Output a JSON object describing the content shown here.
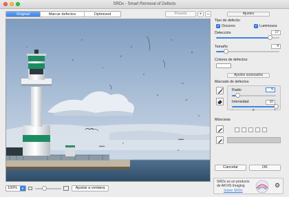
{
  "window": {
    "title": "SRDx - Smart Removal of Defects"
  },
  "view_tabs": [
    {
      "label": "Original",
      "active": true
    },
    {
      "label": "Marcar defectos",
      "active": false
    },
    {
      "label": "Optimized",
      "active": false
    }
  ],
  "presets": {
    "label": "Presets",
    "add": "+",
    "remove": "–"
  },
  "zoom": {
    "value": "100%",
    "slider_fraction": 0.35,
    "fit_label": "Ajustar a ventana"
  },
  "settings": {
    "header": "Ajustes",
    "defect_type_label": "Tipo de defecto:",
    "dark_label": "Oscuros",
    "dark_checked": true,
    "bright_label": "Luminosos",
    "bright_checked": true,
    "detection_label": "Detección",
    "detection_value": "17",
    "detection_fraction": 0.85,
    "size_label": "Tamaño",
    "size_value": "4",
    "size_fraction": 0.15,
    "colors_label": "Colores de defectos:"
  },
  "advanced": {
    "header": "Ajustes avanzados",
    "mark_label": "Marcado de defectos",
    "radius_label": "Radio",
    "radius_value": "5",
    "radius_fraction": 0.12,
    "intensity_label": "Intensidad",
    "intensity_value": "10",
    "intensity_fraction": 1.0,
    "intensity_ticks": [
      "-",
      "0",
      "+"
    ],
    "masks_label": "Máscaras"
  },
  "buttons": {
    "cancel": "Cancelar",
    "ok": "OK"
  },
  "info": {
    "line1": "SRDx es un producto",
    "line2": "de AKVIS Imaging",
    "link": "Sobre SRDx"
  },
  "colors": {
    "accent": "#3d82e6",
    "sky": "#9fb8d4",
    "sea": "#3c5e7c",
    "lighthouse_green": "#1e8c62"
  },
  "icons": [
    "brush-icon",
    "eraser-icon",
    "mask-brush-icon",
    "mask-eraser-icon",
    "settings-gear-icon"
  ]
}
